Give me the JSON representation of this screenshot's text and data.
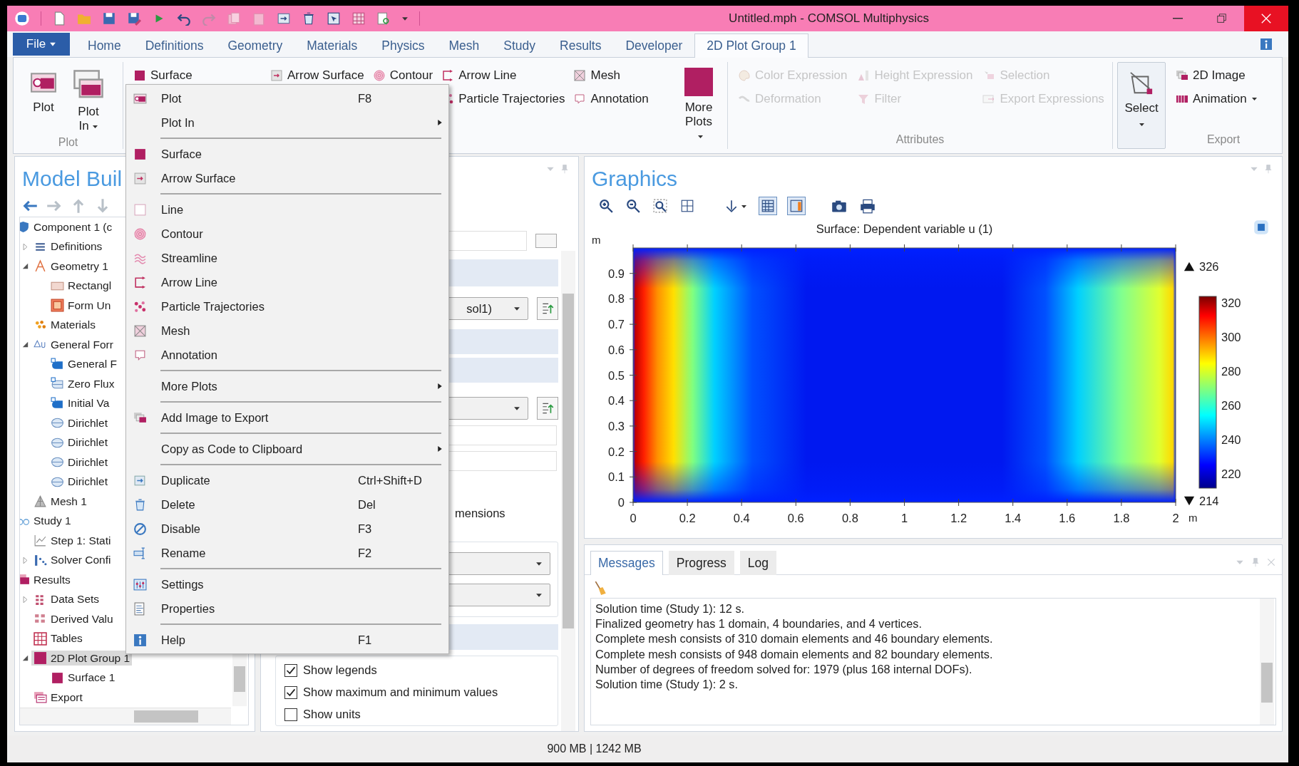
{
  "window": {
    "title": "Untitled.mph - COMSOL Multiphysics"
  },
  "file_button": {
    "label": "File"
  },
  "ribbon_tabs": [
    {
      "label": "Home",
      "selected": false
    },
    {
      "label": "Definitions",
      "selected": false
    },
    {
      "label": "Geometry",
      "selected": false
    },
    {
      "label": "Materials",
      "selected": false
    },
    {
      "label": "Physics",
      "selected": false
    },
    {
      "label": "Mesh",
      "selected": false
    },
    {
      "label": "Study",
      "selected": false
    },
    {
      "label": "Results",
      "selected": false
    },
    {
      "label": "Developer",
      "selected": false
    },
    {
      "label": "2D Plot Group 1",
      "selected": true
    }
  ],
  "ribbon": {
    "plot_group": {
      "label": "Plot",
      "buttons": [
        {
          "label": "Plot",
          "dropdown": false
        },
        {
          "label": "Plot In",
          "dropdown": true
        }
      ]
    },
    "plot_types": [
      [
        {
          "label": "Surface"
        }
      ],
      [
        {
          "label": "Arrow Surface"
        }
      ],
      [
        {
          "label": "Contour"
        }
      ],
      [
        {
          "label": "Arrow Line"
        },
        {
          "label": "Particle Trajectories"
        }
      ],
      [
        {
          "label": "Mesh"
        },
        {
          "label": "Annotation"
        }
      ]
    ],
    "more_plots": {
      "label": "More Plots",
      "dropdown": true
    },
    "attributes": {
      "label": "Attributes",
      "columns": [
        [
          {
            "label": "Color Expression",
            "disabled": true
          },
          {
            "label": "Deformation",
            "disabled": true
          }
        ],
        [
          {
            "label": "Height Expression",
            "disabled": true
          },
          {
            "label": "Filter",
            "disabled": true
          }
        ],
        [
          {
            "label": "Selection",
            "disabled": true
          },
          {
            "label": "Export Expressions",
            "disabled": true
          }
        ]
      ]
    },
    "select": {
      "label": "Select"
    },
    "export": {
      "label": "Export",
      "items": [
        {
          "label": "2D Image",
          "dropdown": false
        },
        {
          "label": "Animation",
          "dropdown": true
        }
      ]
    }
  },
  "model_builder": {
    "title": "Model Buil",
    "tree": [
      {
        "label": "Component 1 (c",
        "kind": "component",
        "selected": false,
        "children": [
          {
            "label": "Definitions",
            "kind": "definitions",
            "selected": false,
            "expanded": false
          },
          {
            "label": "Geometry 1",
            "kind": "geometry",
            "selected": false,
            "expanded": true,
            "children": [
              {
                "label": "Rectangl",
                "kind": "rectangle",
                "selected": false
              },
              {
                "label": "Form Un",
                "kind": "form-union",
                "selected": false
              }
            ]
          },
          {
            "label": "Materials",
            "kind": "materials",
            "selected": false
          },
          {
            "label": "General Forr",
            "kind": "physics",
            "selected": false,
            "expanded": true,
            "children": [
              {
                "label": "General F",
                "kind": "physics-feature",
                "selected": false
              },
              {
                "label": "Zero Flux",
                "kind": "flux",
                "selected": false
              },
              {
                "label": "Initial Va",
                "kind": "physics-feature",
                "selected": false
              },
              {
                "label": "Dirichlet",
                "kind": "boundary",
                "selected": false
              },
              {
                "label": "Dirichlet",
                "kind": "boundary",
                "selected": false
              },
              {
                "label": "Dirichlet",
                "kind": "boundary",
                "selected": false
              },
              {
                "label": "Dirichlet",
                "kind": "boundary",
                "selected": false
              }
            ]
          },
          {
            "label": "Mesh 1",
            "kind": "mesh",
            "selected": false
          }
        ]
      },
      {
        "label": "Study 1",
        "kind": "study",
        "selected": false,
        "children": [
          {
            "label": "Step 1: Stati",
            "kind": "step",
            "selected": false
          },
          {
            "label": "Solver Confi",
            "kind": "solver",
            "selected": false,
            "expanded": false
          }
        ]
      },
      {
        "label": "Results",
        "kind": "results",
        "selected": false,
        "children": [
          {
            "label": "Data Sets",
            "kind": "datasets",
            "selected": false,
            "expanded": false
          },
          {
            "label": "Derived Valu",
            "kind": "derived",
            "selected": false
          },
          {
            "label": "Tables",
            "kind": "tables",
            "selected": false
          },
          {
            "label": "2D Plot Group 1",
            "kind": "plot-group",
            "selected": true,
            "expanded": true,
            "children": [
              {
                "label": "Surface 1",
                "kind": "surface",
                "selected": false
              }
            ]
          },
          {
            "label": "Export",
            "kind": "export",
            "selected": false
          }
        ]
      }
    ]
  },
  "context_menu": {
    "sections": [
      [
        {
          "label": "Plot",
          "shortcut": "F8",
          "submenu": false
        },
        {
          "label": "Plot In",
          "submenu": true
        }
      ],
      [
        {
          "label": "Surface",
          "submenu": false
        },
        {
          "label": "Arrow Surface",
          "submenu": false
        }
      ],
      [
        {
          "label": "Line",
          "submenu": false
        },
        {
          "label": "Contour",
          "submenu": false
        },
        {
          "label": "Streamline",
          "submenu": false
        },
        {
          "label": "Arrow Line",
          "submenu": false
        },
        {
          "label": "Particle Trajectories",
          "submenu": false
        },
        {
          "label": "Mesh",
          "submenu": false
        },
        {
          "label": "Annotation",
          "submenu": false
        }
      ],
      [
        {
          "label": "More Plots",
          "submenu": true
        }
      ],
      [
        {
          "label": "Add Image to Export",
          "submenu": false
        }
      ],
      [
        {
          "label": "Copy as Code to Clipboard",
          "submenu": true
        }
      ],
      [
        {
          "label": "Duplicate",
          "shortcut": "Ctrl+Shift+D",
          "submenu": false
        },
        {
          "label": "Delete",
          "shortcut": "Del",
          "submenu": false
        },
        {
          "label": "Disable",
          "shortcut": "F3",
          "submenu": false
        },
        {
          "label": "Rename",
          "shortcut": "F2",
          "submenu": false
        }
      ],
      [
        {
          "label": "Settings",
          "submenu": false
        },
        {
          "label": "Properties",
          "submenu": false
        }
      ],
      [
        {
          "label": "Help",
          "shortcut": "F1",
          "submenu": false
        }
      ]
    ]
  },
  "settings_panel": {
    "dataset_value": "sol1)",
    "text_fragment": "mensions",
    "checkboxes": [
      {
        "label": "Show legends",
        "checked": true
      },
      {
        "label": "Show maximum and minimum values",
        "checked": true
      },
      {
        "label": "Show units",
        "checked": false
      }
    ]
  },
  "graphics": {
    "title": "Graphics",
    "plot": {
      "title": "Surface: Dependent variable u (1)",
      "y_unit": "m",
      "x_unit": "m",
      "y_ticks": [
        "0.9",
        "0.8",
        "0.7",
        "0.6",
        "0.5",
        "0.4",
        "0.3",
        "0.2",
        "0.1",
        "0"
      ],
      "x_ticks": [
        "0",
        "0.2",
        "0.4",
        "0.6",
        "0.8",
        "1",
        "1.2",
        "1.4",
        "1.6",
        "1.8",
        "2"
      ],
      "colorbar": {
        "max": "326",
        "min": "214",
        "ticks": [
          "320",
          "300",
          "280",
          "260",
          "240",
          "220"
        ]
      }
    }
  },
  "messages_panel": {
    "tabs": [
      {
        "label": "Messages",
        "selected": true
      },
      {
        "label": "Progress",
        "selected": false
      },
      {
        "label": "Log",
        "selected": false
      }
    ],
    "lines": [
      "Solution time (Study 1): 12 s.",
      "Finalized geometry has 1 domain, 4 boundaries, and 4 vertices.",
      "Complete mesh consists of 310 domain elements and 46 boundary elements.",
      "Complete mesh consists of 948 domain elements and 82 boundary elements.",
      "Number of degrees of freedom solved for: 1979 (plus 168 internal DOFs).",
      "Solution time (Study 1): 2 s."
    ]
  },
  "status_bar": {
    "memory": "900 MB | 1242 MB"
  }
}
